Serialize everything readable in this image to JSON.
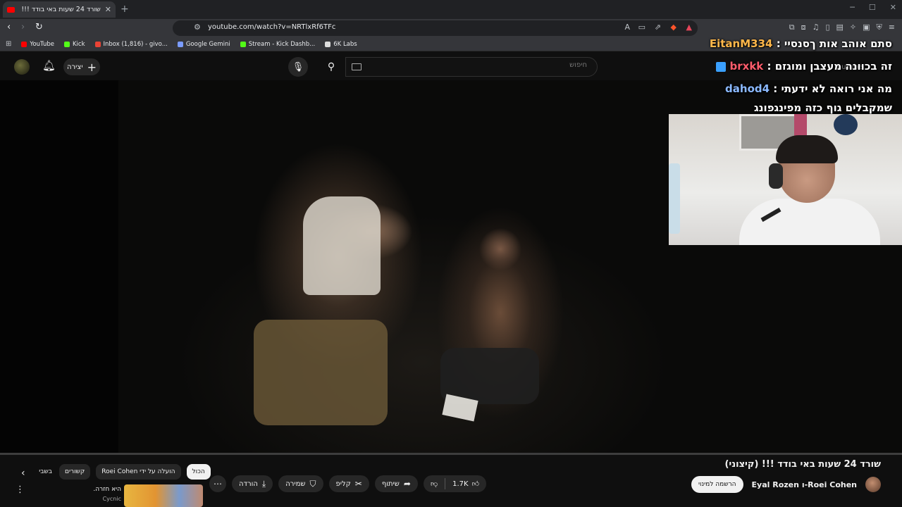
{
  "browser": {
    "tab_title": "שורד 24 שעות באי בודד !!! (קיצוני)",
    "tab_close": "✕",
    "new_tab": "+",
    "url": "youtube.com/watch?v=NRTlxRf6TFc",
    "bookmarks": [
      {
        "label": "YouTube",
        "color": "#ff0000"
      },
      {
        "label": "Kick",
        "color": "#53fc18"
      },
      {
        "label": "Inbox (1,816) - givo...",
        "color": "#ea4335"
      },
      {
        "label": "Google Gemini",
        "color": "#7b9cff"
      },
      {
        "label": "Stream - Kick Dashb...",
        "color": "#53fc18"
      },
      {
        "label": "6K Labs",
        "color": "#dddddd"
      }
    ]
  },
  "youtube": {
    "create_label": "יצירה",
    "search_placeholder": "חיפוש"
  },
  "chat": {
    "messages": [
      {
        "user": "EitanM334",
        "text": "סתם אוהב אות ךסנסיי"
      },
      {
        "user": "brxkk",
        "text": "זה בכוונה מעצבן ומוגזם"
      },
      {
        "user": "dahod4",
        "text": "מה אני רואה לא ידעתי"
      },
      {
        "user": "",
        "text": "שמקבלים גוף כזה מפינגפונג"
      }
    ],
    "watermark": "YouTube"
  },
  "video": {
    "title": "שורד 24 שעות באי בודד !!! (קיצוני)",
    "channel": "Eyal Rozen ו-Roei Cohen",
    "subscribe_label": "הרשמה למינוי",
    "likes": "1.7K",
    "share_label": "שיתוף",
    "clip_label": "קליפ",
    "save_label": "שמירה",
    "download_label": "הורדה",
    "more_label": "⋯"
  },
  "chips": [
    "הכול",
    "הועלה על ידי Roei Cohen",
    "קשורים",
    "בשבי"
  ],
  "recommendation": {
    "title": "היא חזרה.",
    "channel": "Cycnic"
  }
}
